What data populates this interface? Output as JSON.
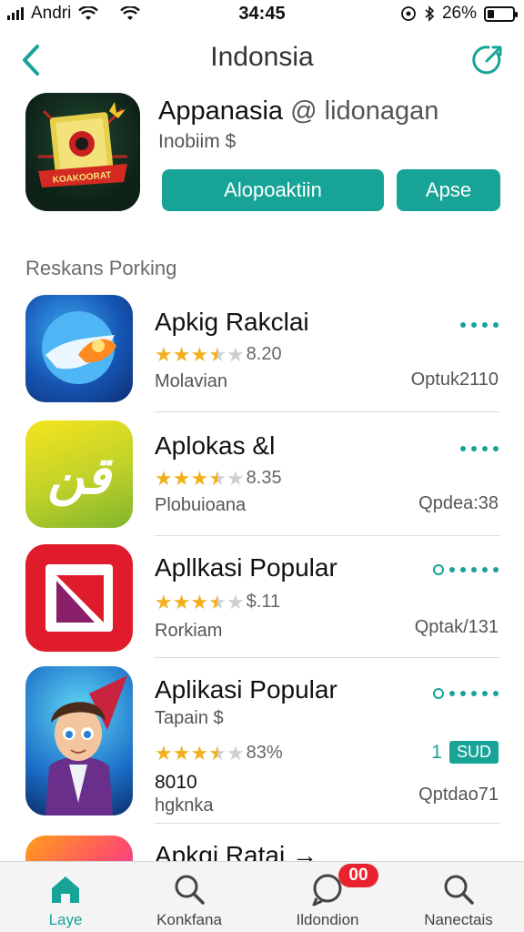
{
  "status_bar": {
    "carrier": "Andri",
    "time": "34:45",
    "battery": "26%",
    "battery_level": 0.26
  },
  "header": {
    "title": "Indonsia"
  },
  "featured": {
    "name": "Appanasia",
    "developer": "@ lidonagan",
    "price": "Inobiim $",
    "primary_button": "Alopoaktiin",
    "secondary_button": "Apse",
    "icon_banner": "KOAKOORAT"
  },
  "section": {
    "title": "Reskans Porking"
  },
  "apps": [
    {
      "name": "Apkig Rakclai",
      "rating": "8.20",
      "stars": 3.5,
      "category": "Molavian",
      "meta": "Optuk2110",
      "icon_text": "",
      "action": "dots"
    },
    {
      "name": "Aplokas &l",
      "rating": "8.35",
      "stars": 3.5,
      "category": "Plobuioana",
      "meta": "Qpdea:38",
      "icon_text": "قن",
      "action": "dots"
    },
    {
      "name": "Apllkasi Popular",
      "rating": "$.11",
      "stars": 3.5,
      "category": "Rorkiam",
      "meta": "Qptak/131",
      "icon_text": "",
      "action": "ring"
    },
    {
      "name": "Aplikasi Popular",
      "sub": "Tapain $",
      "rating": "83%",
      "stars": 3.5,
      "extra": "8010",
      "category": "hgknka",
      "meta": "Qptdao71",
      "badge_num": "1",
      "badge_text": "SUD",
      "icon_text": "",
      "action": "ring"
    },
    {
      "name": "Apkgi Ratai →",
      "icon_text": ""
    }
  ],
  "tabbar": {
    "tabs": [
      {
        "label": "Laye"
      },
      {
        "label": "Konkfana"
      },
      {
        "label": "Ildondion",
        "badge": "00"
      },
      {
        "label": "Nanectais"
      }
    ]
  },
  "colors": {
    "accent": "#17a497",
    "badge": "#e8232f",
    "star": "#f2b01e"
  }
}
